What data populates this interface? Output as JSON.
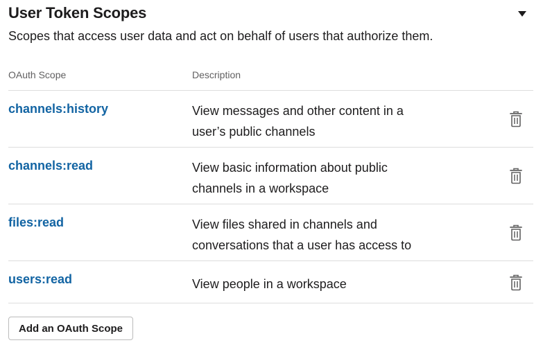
{
  "section": {
    "title": "User Token Scopes",
    "subtitle": "Scopes that access user data and act on behalf of users that authorize them."
  },
  "table": {
    "headers": {
      "scope": "OAuth Scope",
      "description": "Description"
    },
    "rows": [
      {
        "scope": "channels:history",
        "description_line1": "View messages and other content in a",
        "description_line2": "user’s public channels"
      },
      {
        "scope": "channels:read",
        "description_line1": "View basic information about public",
        "description_line2": "channels in a workspace"
      },
      {
        "scope": "files:read",
        "description_line1": "View files shared in channels and",
        "description_line2": "conversations that a user has access to"
      },
      {
        "scope": "users:read",
        "description_line1": "View people in a workspace",
        "description_line2": ""
      }
    ]
  },
  "actions": {
    "add_scope_label": "Add an OAuth Scope"
  },
  "icons": {
    "collapse": "caret-down-icon",
    "remove": "trash-icon"
  },
  "colors": {
    "link": "#1264a3",
    "text": "#1d1c1d",
    "muted": "#616061",
    "divider": "#dddddd"
  }
}
